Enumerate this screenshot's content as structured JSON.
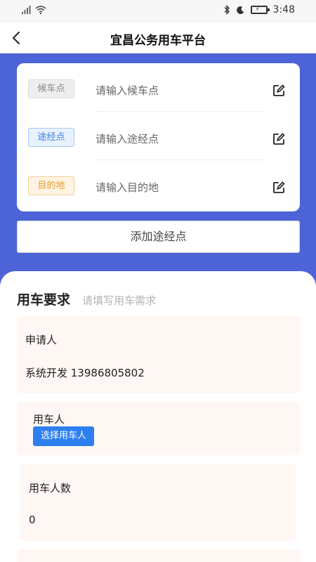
{
  "status_bar": {
    "time": "3:48"
  },
  "header": {
    "title": "宜昌公务用车平台"
  },
  "route": {
    "rows": [
      {
        "tag": "候车点",
        "placeholder": "请输入候车点"
      },
      {
        "tag": "途经点",
        "placeholder": "请输入途经点"
      },
      {
        "tag": "目的地",
        "placeholder": "请输入目的地"
      }
    ],
    "add_waypoint_label": "添加途经点"
  },
  "requirements": {
    "title": "用车要求",
    "subtitle": "请填写用车需求",
    "applicant": {
      "label": "申请人",
      "value": "系统开发 13986805802"
    },
    "car_user": {
      "label": "用车人",
      "button_label": "选择用车人"
    },
    "passenger_count": {
      "label": "用车人数",
      "value": "0"
    }
  },
  "colors": {
    "primary_blue": "#4d63d8",
    "button_blue": "#2d7ff0",
    "card_bg": "#fff7f3"
  }
}
